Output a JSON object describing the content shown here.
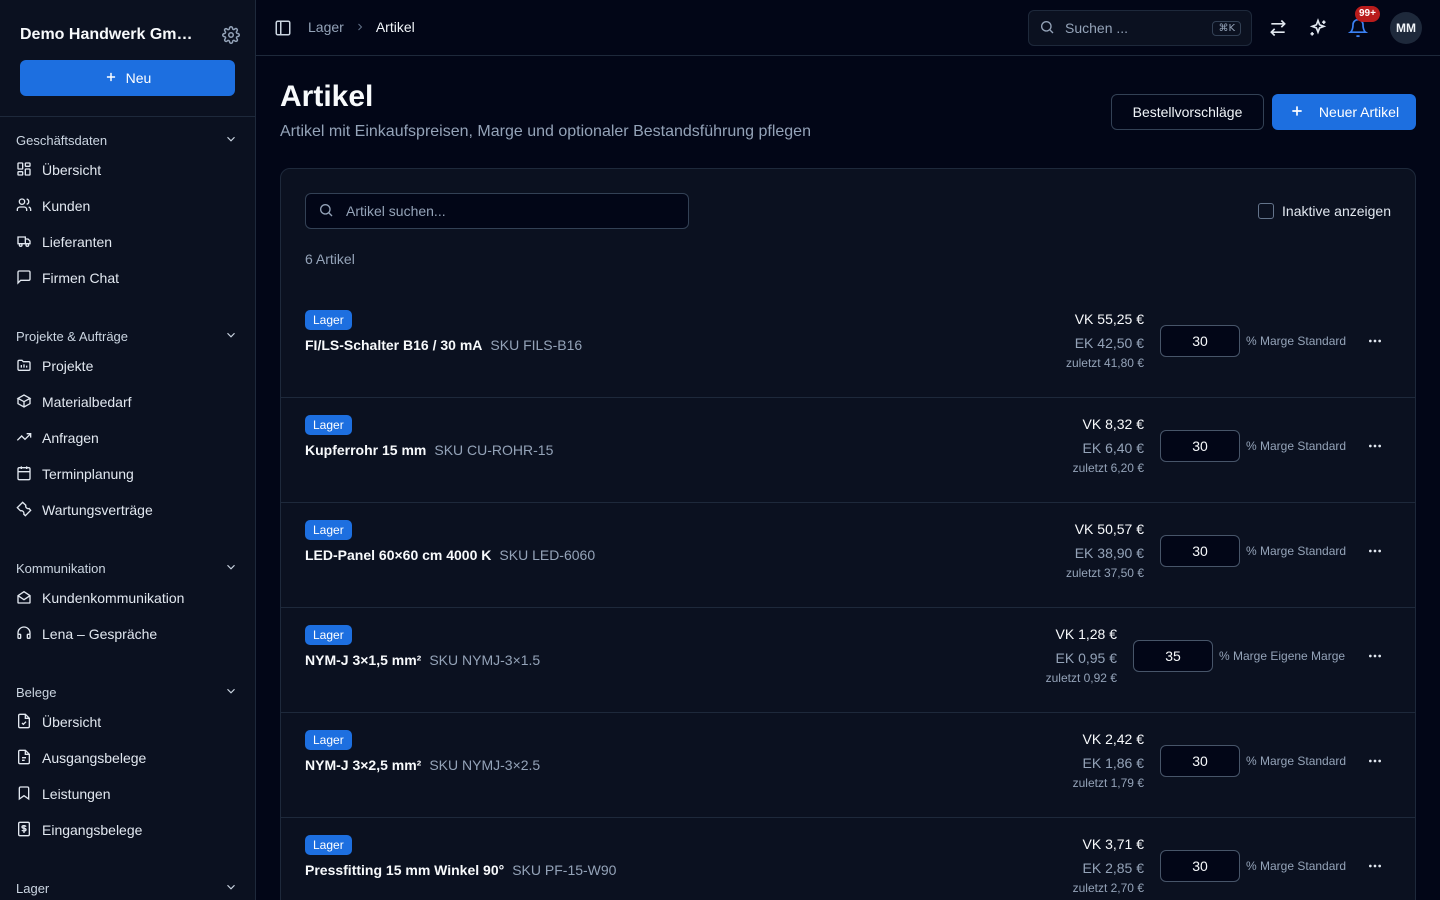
{
  "sidebar": {
    "company": "Demo Handwerk GmbH",
    "new_label": "Neu",
    "sections": [
      {
        "title": "Geschäftsdaten",
        "items": [
          {
            "label": "Übersicht",
            "icon": "dashboard-icon"
          },
          {
            "label": "Kunden",
            "icon": "users-icon"
          },
          {
            "label": "Lieferanten",
            "icon": "truck-icon"
          },
          {
            "label": "Firmen Chat",
            "icon": "chat-icon"
          }
        ]
      },
      {
        "title": "Projekte & Aufträge",
        "items": [
          {
            "label": "Projekte",
            "icon": "folder-icon"
          },
          {
            "label": "Materialbedarf",
            "icon": "package-icon"
          },
          {
            "label": "Anfragen",
            "icon": "trend-icon"
          },
          {
            "label": "Terminplanung",
            "icon": "calendar-icon"
          },
          {
            "label": "Wartungsverträge",
            "icon": "wrench-icon"
          }
        ]
      },
      {
        "title": "Kommunikation",
        "items": [
          {
            "label": "Kundenkommunikation",
            "icon": "mail-open-icon"
          },
          {
            "label": "Lena – Gespräche",
            "icon": "headset-icon"
          }
        ]
      },
      {
        "title": "Belege",
        "items": [
          {
            "label": "Übersicht",
            "icon": "file-icon"
          },
          {
            "label": "Ausgangsbelege",
            "icon": "file-out-icon"
          },
          {
            "label": "Leistungen",
            "icon": "bookmark-icon"
          },
          {
            "label": "Eingangsbelege",
            "icon": "receipt-icon"
          }
        ]
      },
      {
        "title": "Lager",
        "items": []
      }
    ]
  },
  "topbar": {
    "breadcrumb": [
      "Lager",
      "Artikel"
    ],
    "search_placeholder": "Suchen ...",
    "search_shortcut": "⌘K",
    "notification_count": "99+",
    "avatar_initials": "MM"
  },
  "page": {
    "title": "Artikel",
    "subtitle": "Artikel mit Einkaufspreisen, Marge und optionaler Bestandsführung pflegen",
    "btn_suggestions": "Bestellvorschläge",
    "btn_new": "Neuer Artikel",
    "search_placeholder": "Artikel suchen...",
    "show_inactive": "Inaktive anzeigen",
    "count": "6 Artikel"
  },
  "articles": [
    {
      "tag": "Lager",
      "name": "FI/LS-Schalter B16 / 30 mA",
      "sku": "SKU FILS-B16",
      "vk": "VK 55,25 €",
      "ek": "EK 42,50 €",
      "last": "zuletzt 41,80 €",
      "margin": "30",
      "margin_label": "% Marge Standard"
    },
    {
      "tag": "Lager",
      "name": "Kupferrohr 15 mm",
      "sku": "SKU CU-ROHR-15",
      "vk": "VK 8,32 €",
      "ek": "EK 6,40 €",
      "last": "zuletzt 6,20 €",
      "margin": "30",
      "margin_label": "% Marge Standard"
    },
    {
      "tag": "Lager",
      "name": "LED-Panel 60×60 cm 4000 K",
      "sku": "SKU LED-6060",
      "vk": "VK 50,57 €",
      "ek": "EK 38,90 €",
      "last": "zuletzt 37,50 €",
      "margin": "30",
      "margin_label": "% Marge Standard"
    },
    {
      "tag": "Lager",
      "name": "NYM-J 3×1,5 mm²",
      "sku": "SKU NYMJ-3×1.5",
      "vk": "VK 1,28 €",
      "ek": "EK 0,95 €",
      "last": "zuletzt 0,92 €",
      "margin": "35",
      "margin_label": "% Marge Eigene Marge"
    },
    {
      "tag": "Lager",
      "name": "NYM-J 3×2,5 mm²",
      "sku": "SKU NYMJ-3×2.5",
      "vk": "VK 2,42 €",
      "ek": "EK 1,86 €",
      "last": "zuletzt 1,79 €",
      "margin": "30",
      "margin_label": "% Marge Standard"
    },
    {
      "tag": "Lager",
      "name": "Pressfitting 15 mm Winkel 90°",
      "sku": "SKU PF-15-W90",
      "vk": "VK 3,71 €",
      "ek": "EK 2,85 €",
      "last": "zuletzt 2,70 €",
      "margin": "30",
      "margin_label": "% Marge Standard"
    }
  ]
}
